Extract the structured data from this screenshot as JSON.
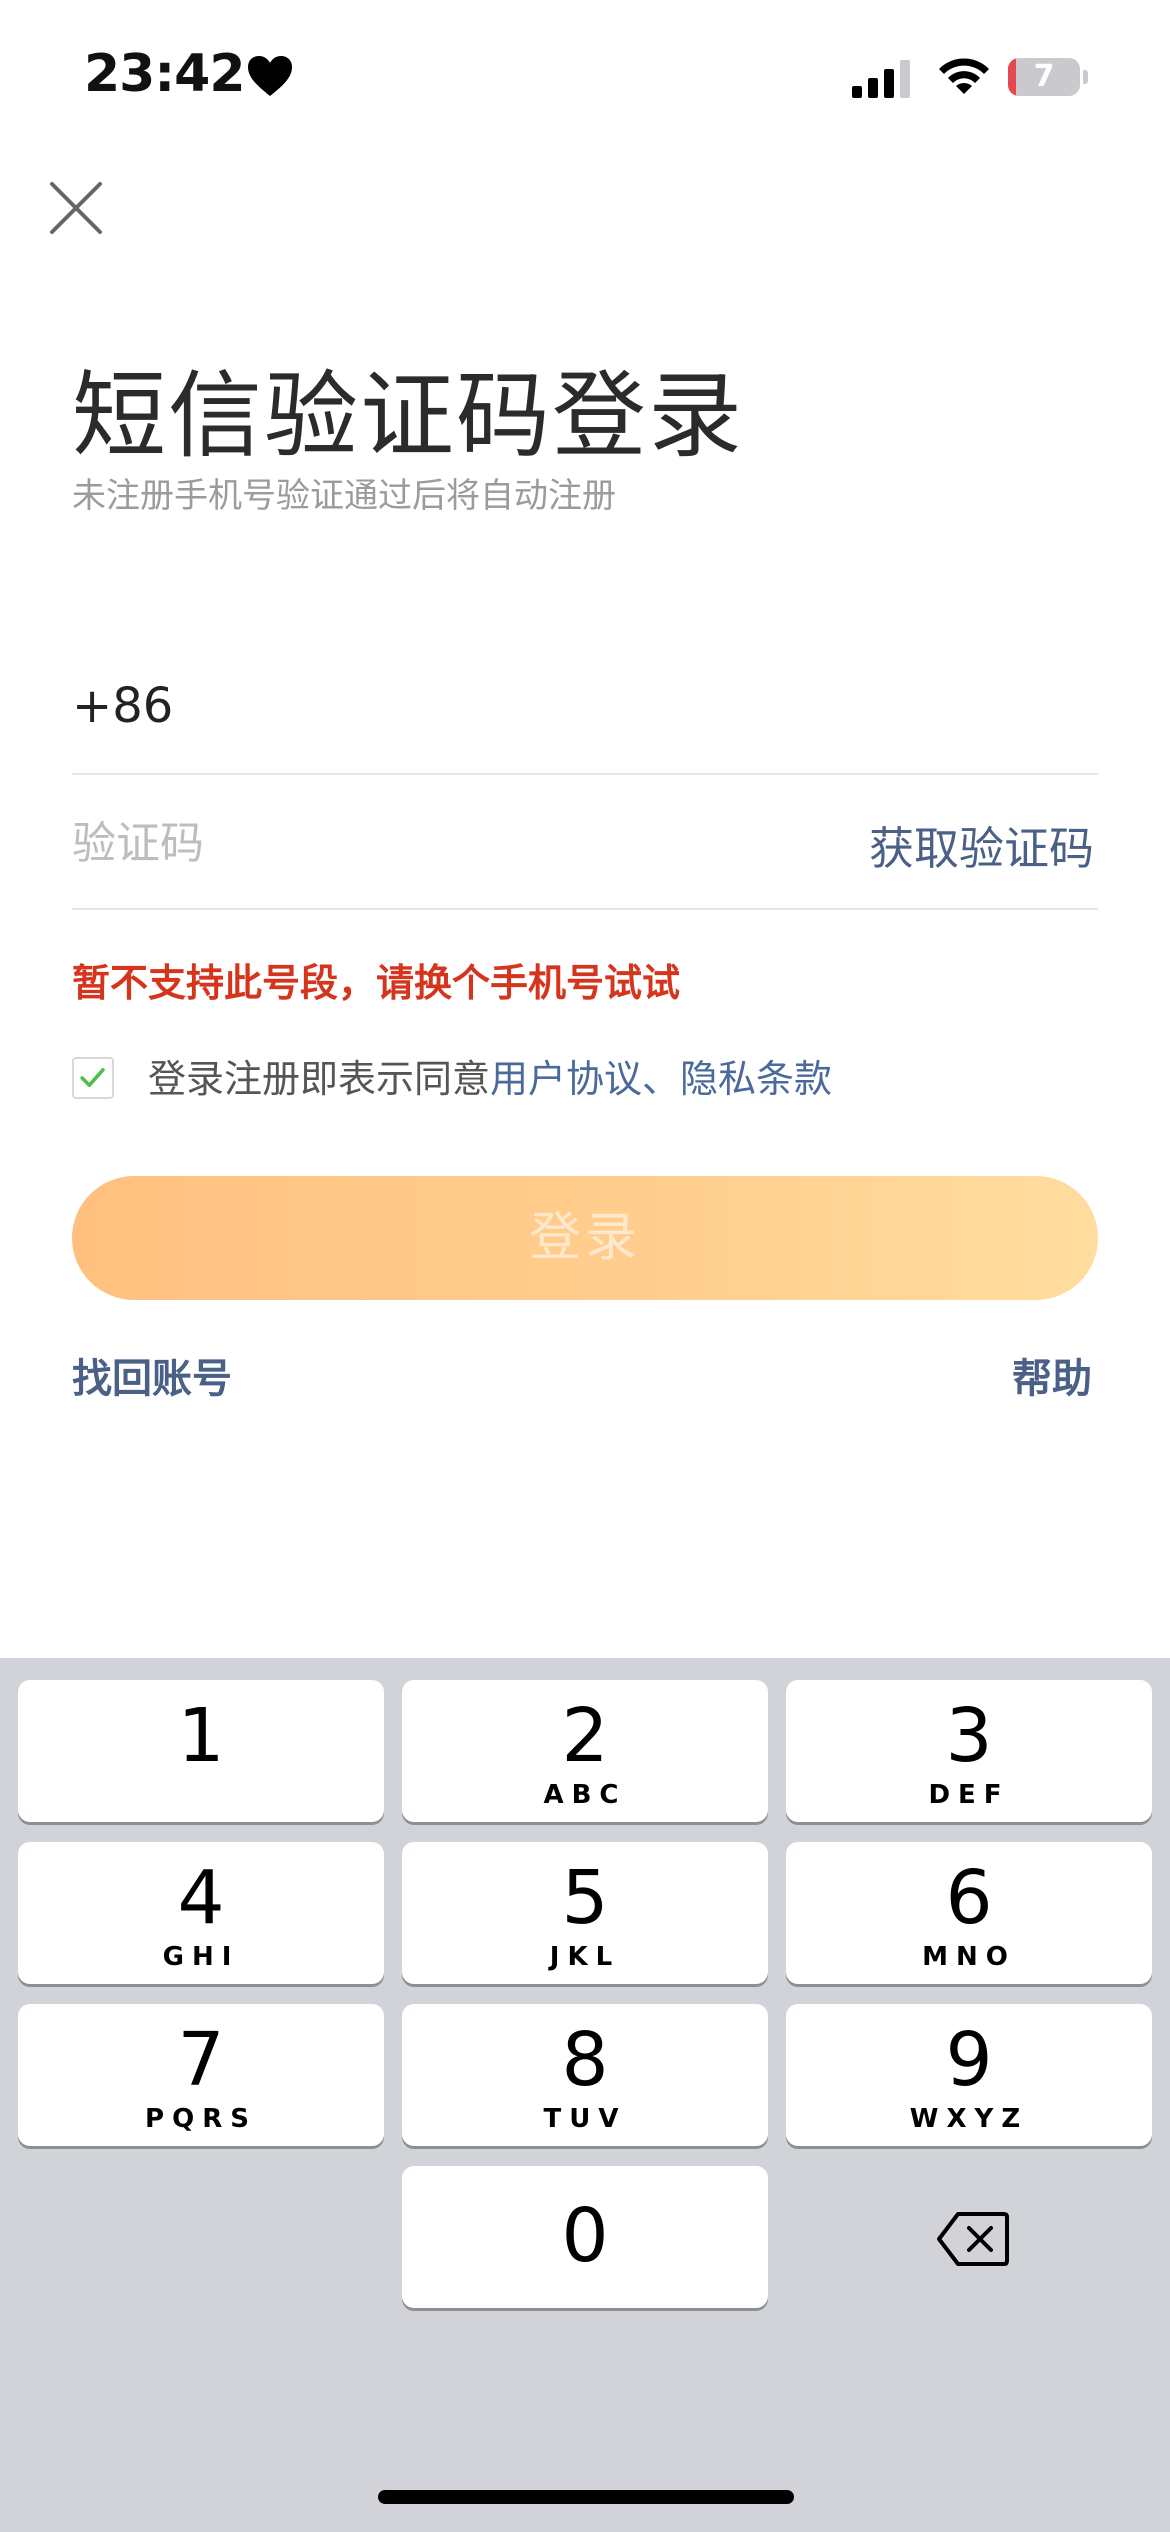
{
  "status_bar": {
    "time": "23:42",
    "battery": "7"
  },
  "header": {
    "title": "短信验证码登录",
    "subtitle": "未注册手机号验证通过后将自动注册"
  },
  "form": {
    "country_code": "+86",
    "code_placeholder": "验证码",
    "get_code_label": "获取验证码",
    "error_message": "暂不支持此号段，请换个手机号试试",
    "agreement_prefix": "登录注册即表示同意",
    "user_agreement": "用户协议",
    "separator": "、",
    "privacy_policy": "隐私条款",
    "checkbox_checked": true,
    "login_label": "登录"
  },
  "footer_links": {
    "find_account": "找回账号",
    "help": "帮助"
  },
  "keyboard": {
    "keys": [
      {
        "digit": "1",
        "letters": ""
      },
      {
        "digit": "2",
        "letters": "ABC"
      },
      {
        "digit": "3",
        "letters": "DEF"
      },
      {
        "digit": "4",
        "letters": "GHI"
      },
      {
        "digit": "5",
        "letters": "JKL"
      },
      {
        "digit": "6",
        "letters": "MNO"
      },
      {
        "digit": "7",
        "letters": "PQRS"
      },
      {
        "digit": "8",
        "letters": "TUV"
      },
      {
        "digit": "9",
        "letters": "WXYZ"
      },
      {
        "digit": "0",
        "letters": ""
      }
    ]
  },
  "colors": {
    "accent_link": "#4a6087",
    "error": "#d4351c",
    "check_green": "#4cbf4a",
    "button_gradient_start": "#ffc07f",
    "button_gradient_end": "#ffdd9f"
  },
  "icons": [
    "heart-icon",
    "cellular-signal-icon",
    "wifi-icon",
    "battery-icon",
    "close-icon",
    "checkmark-icon",
    "backspace-icon"
  ]
}
